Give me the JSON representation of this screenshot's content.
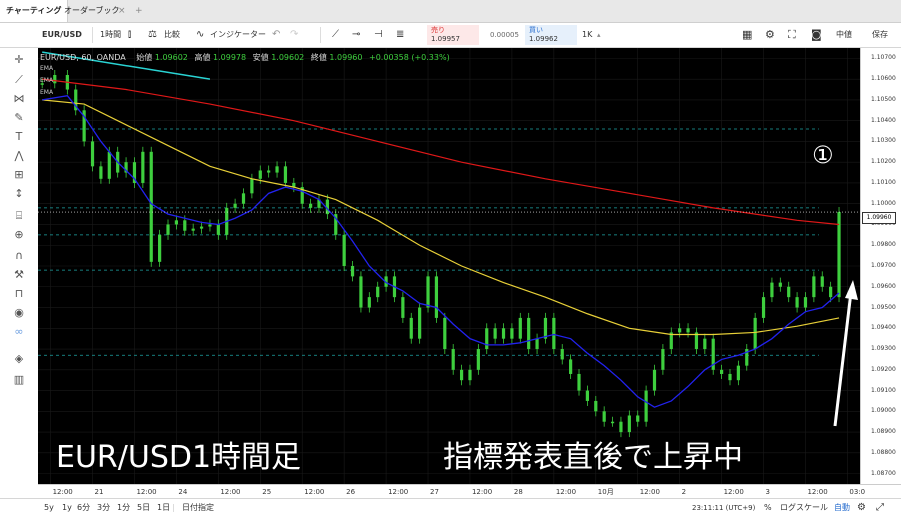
{
  "tabs": [
    {
      "label": "チャーティング"
    },
    {
      "label": "オーダーブック"
    }
  ],
  "tab_close": "×",
  "tab_add": "+",
  "toolbar": {
    "symbol": "EUR/USD",
    "interval": "1時間",
    "compare": "比較",
    "indicators": "インジケーター",
    "sell_label": "売り",
    "sell_price": "1.09957",
    "spread": "0.00005",
    "buy_label": "買い",
    "buy_price": "1.09962",
    "lot": "1K",
    "price_mode": "中値",
    "save": "保存"
  },
  "legend": {
    "symbol_line": "EUR/USD, 60, OANDA",
    "open_label": "始値",
    "open": "1.09602",
    "high_label": "高値",
    "high": "1.09978",
    "low_label": "安値",
    "low": "1.09602",
    "close_label": "終値",
    "close": "1.09960",
    "change": "+0.00358 (+0.33%)",
    "ema_labels": [
      "EMA",
      "EMA",
      "EMA"
    ]
  },
  "overlay": {
    "left_caption": "EUR/USD1時間足",
    "right_caption": "指標発表直後で上昇中",
    "marker": "①"
  },
  "current_price_tag": "1.09960",
  "bottom_bar": {
    "periods": [
      "5y",
      "1y",
      "6分",
      "3分",
      "1分",
      "5日",
      "1日"
    ],
    "goto_date": "日付指定",
    "time": "23:11:11 (UTC+9)",
    "percent": "%",
    "log_scale": "ログスケール",
    "auto": "自動"
  },
  "colors": {
    "chart_bg": "#000000",
    "candle": "#3ecf3e",
    "ema_fast": "#2222ee",
    "ema_mid": "#e8d038",
    "ema_slow": "#e01818",
    "trendline": "#2ad4d4",
    "dashed_level": "#1ea6a6"
  },
  "chart_data": {
    "type": "line",
    "title": "EUR/USD, 60, OANDA",
    "y_ticks": [
      "1.10700",
      "1.10600",
      "1.10500",
      "1.10400",
      "1.10300",
      "1.10200",
      "1.10100",
      "1.10000",
      "1.09900",
      "1.09800",
      "1.09700",
      "1.09600",
      "1.09500",
      "1.09400",
      "1.09300",
      "1.09200",
      "1.09100",
      "1.09000",
      "1.08900",
      "1.08800",
      "1.08700"
    ],
    "ylim": [
      1.0865,
      1.1075
    ],
    "x_ticks": [
      {
        "label": "12:00",
        "x": 2
      },
      {
        "label": "21",
        "x": 12
      },
      {
        "label": "12:00",
        "x": 22
      },
      {
        "label": "24",
        "x": 32
      },
      {
        "label": "12:00",
        "x": 42
      },
      {
        "label": "25",
        "x": 52
      },
      {
        "label": "12:00",
        "x": 62
      },
      {
        "label": "26",
        "x": 72
      },
      {
        "label": "12:00",
        "x": 82
      },
      {
        "label": "27",
        "x": 92
      },
      {
        "label": "12:00",
        "x": 102
      },
      {
        "label": "28",
        "x": 112
      },
      {
        "label": "12:00",
        "x": 122
      },
      {
        "label": "10月",
        "x": 132
      },
      {
        "label": "12:00",
        "x": 142
      },
      {
        "label": "2",
        "x": 152
      },
      {
        "label": "12:00",
        "x": 162
      },
      {
        "label": "3",
        "x": 172
      },
      {
        "label": "12:00",
        "x": 182
      },
      {
        "label": "03:0",
        "x": 192
      }
    ],
    "xlim": [
      -1,
      195
    ],
    "series": [
      {
        "kind": "price",
        "x": [
          0,
          3,
          6,
          8,
          10,
          12,
          14,
          16,
          18,
          20,
          22,
          24,
          26,
          28,
          30,
          32,
          34,
          36,
          38,
          40,
          42,
          44,
          46,
          48,
          50,
          52,
          54,
          56,
          58,
          60,
          62,
          64,
          66,
          68,
          70,
          72,
          74,
          76,
          78,
          80,
          82,
          84,
          86,
          88,
          90,
          92,
          94,
          96,
          98,
          100,
          102,
          104,
          106,
          108,
          110,
          112,
          114,
          116,
          118,
          120,
          122,
          124,
          126,
          128,
          130,
          132,
          134,
          136,
          138,
          140,
          142,
          144,
          146,
          148,
          150,
          152,
          154,
          156,
          158,
          160,
          162,
          164,
          166,
          168,
          170,
          172,
          174,
          176,
          178,
          180,
          182,
          184,
          186,
          188,
          190
        ],
        "y": [
          1.1058,
          1.1062,
          1.1055,
          1.1045,
          1.103,
          1.1018,
          1.1012,
          1.1025,
          1.1015,
          1.102,
          1.101,
          1.1025,
          1.0972,
          1.0985,
          1.099,
          1.0992,
          1.0987,
          1.0988,
          1.0989,
          1.099,
          1.0985,
          1.0998,
          1.1,
          1.1005,
          1.1012,
          1.1016,
          1.1015,
          1.1018,
          1.101,
          1.1008,
          1.1,
          1.0998,
          1.1002,
          1.0995,
          1.0985,
          1.097,
          1.0965,
          1.095,
          1.0955,
          1.096,
          1.0965,
          1.0955,
          1.0945,
          1.0935,
          1.095,
          1.0965,
          1.0945,
          1.093,
          1.092,
          1.0915,
          1.092,
          1.093,
          1.094,
          1.0935,
          1.094,
          1.0935,
          1.0945,
          1.093,
          1.0935,
          1.0945,
          1.093,
          1.0925,
          1.0918,
          1.091,
          1.0905,
          1.09,
          1.0895,
          1.0895,
          1.089,
          1.0898,
          1.0895,
          1.091,
          1.092,
          1.093,
          1.0938,
          1.094,
          1.0938,
          1.093,
          1.0935,
          1.092,
          1.0918,
          1.0915,
          1.0922,
          1.093,
          1.0945,
          1.0955,
          1.0962,
          1.096,
          1.0955,
          1.095,
          1.0955,
          1.0965,
          1.096,
          1.0955,
          1.0996
        ]
      },
      {
        "kind": "ema_fast",
        "x": [
          0,
          6,
          10,
          14,
          18,
          22,
          26,
          30,
          34,
          38,
          42,
          46,
          50,
          54,
          58,
          62,
          66,
          70,
          74,
          78,
          82,
          86,
          90,
          94,
          98,
          102,
          106,
          110,
          114,
          118,
          122,
          126,
          130,
          134,
          138,
          142,
          146,
          150,
          154,
          158,
          162,
          166,
          170,
          174,
          178,
          182,
          186,
          190
        ],
        "y": [
          1.105,
          1.1052,
          1.1042,
          1.103,
          1.102,
          1.1012,
          1.1,
          1.0995,
          1.0993,
          1.0991,
          1.099,
          1.0993,
          1.0997,
          1.1005,
          1.1008,
          1.1006,
          1.1002,
          1.0993,
          1.0982,
          1.097,
          1.0962,
          1.0958,
          1.0952,
          1.095,
          1.0942,
          1.0935,
          1.0932,
          1.0932,
          1.0933,
          1.0935,
          1.0937,
          1.0935,
          1.0928,
          1.0922,
          1.0915,
          1.0907,
          1.0902,
          1.0905,
          1.0912,
          1.092,
          1.0925,
          1.0927,
          1.093,
          1.0935,
          1.0942,
          1.0948,
          1.095,
          1.0957
        ]
      },
      {
        "kind": "ema_mid",
        "x": [
          0,
          10,
          20,
          30,
          40,
          50,
          60,
          70,
          80,
          90,
          100,
          110,
          120,
          130,
          140,
          150,
          160,
          170,
          180,
          190
        ],
        "y": [
          1.105,
          1.1048,
          1.1038,
          1.1028,
          1.1018,
          1.1012,
          1.1008,
          1.1002,
          1.0992,
          1.098,
          1.097,
          1.0962,
          1.0955,
          1.0947,
          1.094,
          1.0937,
          1.0937,
          1.0938,
          1.0941,
          1.0945
        ]
      },
      {
        "kind": "ema_slow",
        "x": [
          0,
          20,
          40,
          60,
          80,
          100,
          120,
          140,
          160,
          180,
          190
        ],
        "y": [
          1.106,
          1.1055,
          1.1048,
          1.104,
          1.103,
          1.102,
          1.1012,
          1.1005,
          1.0998,
          1.0992,
          1.099
        ]
      }
    ],
    "trendline": {
      "x": [
        0,
        40
      ],
      "y": [
        1.1073,
        1.106
      ]
    },
    "horizontal_levels": [
      1.1036,
      1.0998,
      1.0985,
      1.0968,
      1.0927
    ],
    "grid": true
  }
}
